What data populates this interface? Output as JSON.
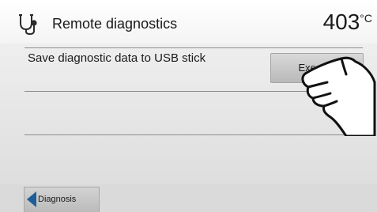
{
  "header": {
    "icon": "stethoscope-icon",
    "title": "Remote diagnostics",
    "temperature": "403",
    "temperature_unit": "°C"
  },
  "rows": [
    {
      "label": "Save diagnostic data to USB stick",
      "button_label": "Execute"
    }
  ],
  "footer": {
    "back_icon": "back-arrow-icon",
    "back_label": "Diagnosis"
  },
  "overlay": {
    "icon": "pointing-hand-icon"
  },
  "colors": {
    "header_bg": "#ffffff",
    "content_bg": "#e5e5e5",
    "back_arrow": "#1f5d98"
  }
}
